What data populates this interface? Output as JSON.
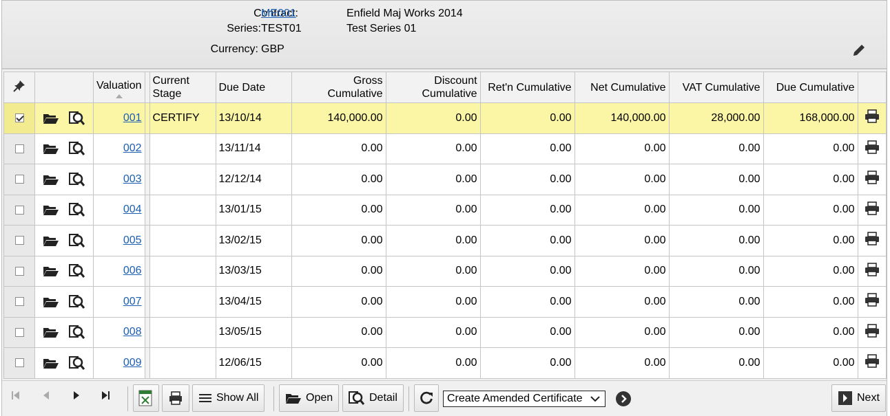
{
  "header": {
    "contract_label": "Contract:",
    "contract_value": "ME001",
    "contract_name": "Enfield Maj Works 2014",
    "series_label": "Series:",
    "series_value": "TEST01",
    "series_name": "Test Series 01",
    "currency_label": "Currency:",
    "currency_value": "GBP"
  },
  "table": {
    "headers": {
      "valuation": "Valuation",
      "current_stage_1": "Current",
      "current_stage_2": "Stage",
      "due_date": "Due Date",
      "gross_1": "Gross",
      "gross_2": "Cumulative",
      "discount_1": "Discount",
      "discount_2": "Cumulative",
      "retn": "Ret'n Cumulative",
      "net": "Net Cumulative",
      "vat": "VAT Cumulative",
      "due": "Due Cumulative"
    },
    "rows": [
      {
        "valuation": "001",
        "stage": "CERTIFY",
        "due_date": "13/10/14",
        "gross": "140,000.00",
        "discount": "0.00",
        "retn": "0.00",
        "net": "140,000.00",
        "vat": "28,000.00",
        "due": "168,000.00",
        "checked": true
      },
      {
        "valuation": "002",
        "stage": "",
        "due_date": "13/11/14",
        "gross": "0.00",
        "discount": "0.00",
        "retn": "0.00",
        "net": "0.00",
        "vat": "0.00",
        "due": "0.00",
        "checked": false
      },
      {
        "valuation": "003",
        "stage": "",
        "due_date": "12/12/14",
        "gross": "0.00",
        "discount": "0.00",
        "retn": "0.00",
        "net": "0.00",
        "vat": "0.00",
        "due": "0.00",
        "checked": false
      },
      {
        "valuation": "004",
        "stage": "",
        "due_date": "13/01/15",
        "gross": "0.00",
        "discount": "0.00",
        "retn": "0.00",
        "net": "0.00",
        "vat": "0.00",
        "due": "0.00",
        "checked": false
      },
      {
        "valuation": "005",
        "stage": "",
        "due_date": "13/02/15",
        "gross": "0.00",
        "discount": "0.00",
        "retn": "0.00",
        "net": "0.00",
        "vat": "0.00",
        "due": "0.00",
        "checked": false
      },
      {
        "valuation": "006",
        "stage": "",
        "due_date": "13/03/15",
        "gross": "0.00",
        "discount": "0.00",
        "retn": "0.00",
        "net": "0.00",
        "vat": "0.00",
        "due": "0.00",
        "checked": false
      },
      {
        "valuation": "007",
        "stage": "",
        "due_date": "13/04/15",
        "gross": "0.00",
        "discount": "0.00",
        "retn": "0.00",
        "net": "0.00",
        "vat": "0.00",
        "due": "0.00",
        "checked": false
      },
      {
        "valuation": "008",
        "stage": "",
        "due_date": "13/05/15",
        "gross": "0.00",
        "discount": "0.00",
        "retn": "0.00",
        "net": "0.00",
        "vat": "0.00",
        "due": "0.00",
        "checked": false
      },
      {
        "valuation": "009",
        "stage": "",
        "due_date": "12/06/15",
        "gross": "0.00",
        "discount": "0.00",
        "retn": "0.00",
        "net": "0.00",
        "vat": "0.00",
        "due": "0.00",
        "checked": false
      }
    ]
  },
  "toolbar": {
    "show_all_label": "Show All",
    "open_label": "Open",
    "detail_label": "Detail",
    "action_select_value": "Create Amended Certificate",
    "next_label": "Next"
  },
  "colors": {
    "selected_row": "#fbf5a6",
    "link": "#1a5fb4"
  }
}
